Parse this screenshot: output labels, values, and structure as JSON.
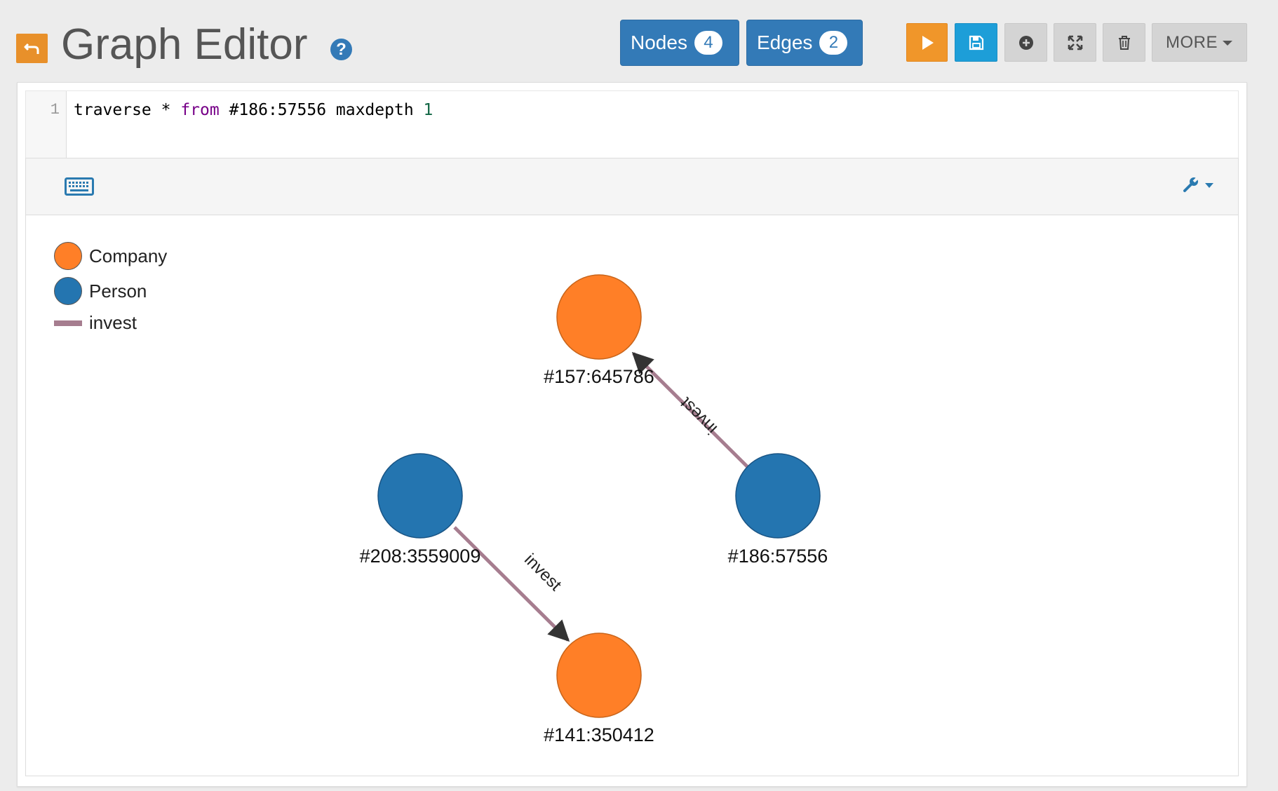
{
  "header": {
    "title": "Graph Editor",
    "help_glyph": "?",
    "nodes_label": "Nodes",
    "nodes_count": "4",
    "edges_label": "Edges",
    "edges_count": "2",
    "more_label": "MORE"
  },
  "editor": {
    "line_number": "1",
    "query_tokens": {
      "t1": "traverse * ",
      "t2": "from",
      "t3": " #186:57556 maxdepth ",
      "t4": "1"
    }
  },
  "legend": {
    "company": "Company",
    "person": "Person",
    "invest": "invest"
  },
  "graph": {
    "nodes": {
      "n157": "#157:645786",
      "n208": "#208:3559009",
      "n186": "#186:57556",
      "n141": "#141:350412"
    },
    "edges": {
      "e1": "invest",
      "e2": "invest"
    }
  },
  "colors": {
    "company": "#ff7f27",
    "person": "#2475b0",
    "invest_edge": "#a67d8f",
    "primary": "#337ab7",
    "run": "#f0962a",
    "save": "#1d9ed8"
  },
  "icons": [
    "back-arrow-icon",
    "help-icon",
    "play-icon",
    "save-icon",
    "add-icon",
    "fullscreen-icon",
    "trash-icon",
    "chevron-down-icon",
    "keyboard-icon",
    "wrench-icon"
  ]
}
